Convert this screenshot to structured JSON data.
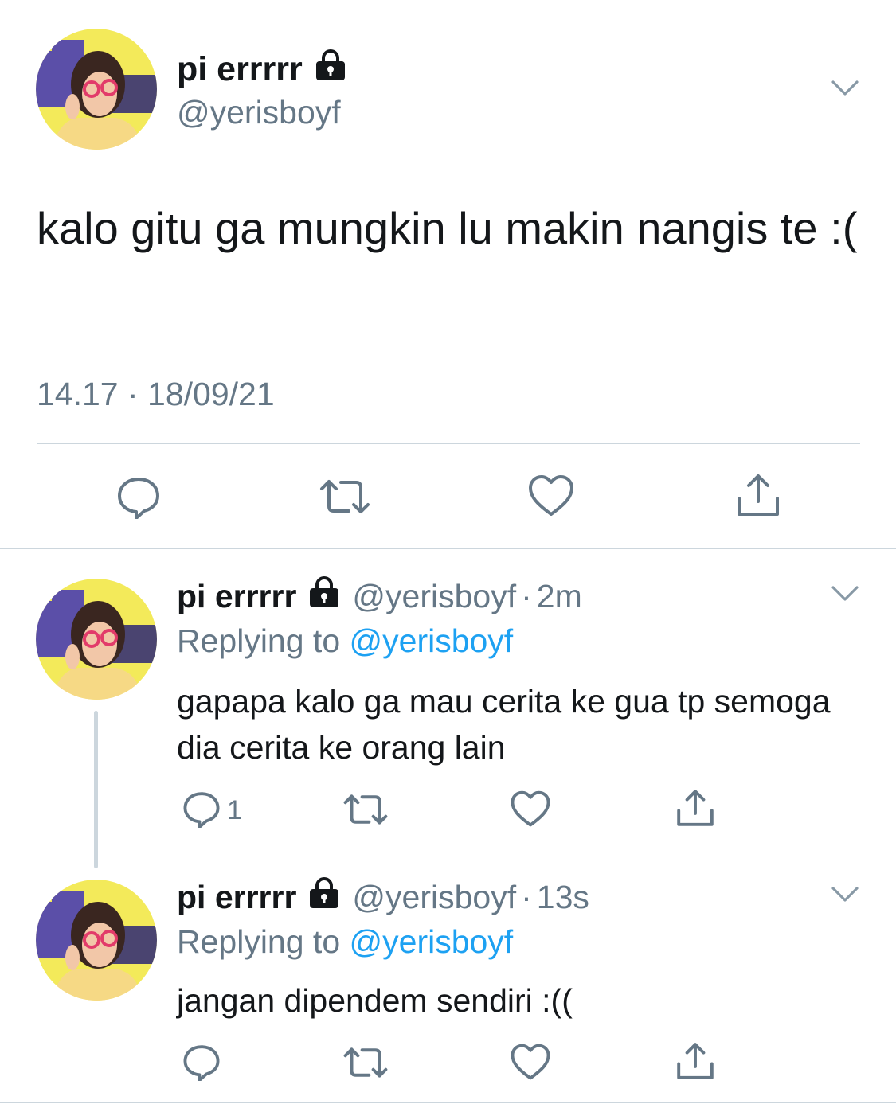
{
  "colors": {
    "text": "#14171a",
    "secondary": "#657786",
    "accent": "#1da1f2",
    "divider": "#ccd6dd"
  },
  "main_tweet": {
    "display_name": "pi errrrr",
    "handle": "@yerisboyf",
    "text": "kalo gitu ga mungkin lu makin nangis te :(",
    "timestamp": "14.17 · 18/09/21",
    "icons": [
      "avatar",
      "lock-icon",
      "chevron-down-icon",
      "reply-icon",
      "retweet-icon",
      "like-icon",
      "share-icon"
    ]
  },
  "replies": [
    {
      "display_name": "pi errrrr",
      "handle": "@yerisboyf",
      "separator": "·",
      "time": "2m",
      "replying_prefix": "Replying to ",
      "replying_to": "@yerisboyf",
      "text": "gapapa kalo ga mau cerita ke gua tp semoga dia cerita ke orang lain",
      "reply_count": "1"
    },
    {
      "display_name": "pi errrrr",
      "handle": "@yerisboyf",
      "separator": "·",
      "time": "13s",
      "replying_prefix": "Replying to ",
      "replying_to": "@yerisboyf",
      "text": "jangan dipendem sendiri :((",
      "reply_count": ""
    }
  ]
}
